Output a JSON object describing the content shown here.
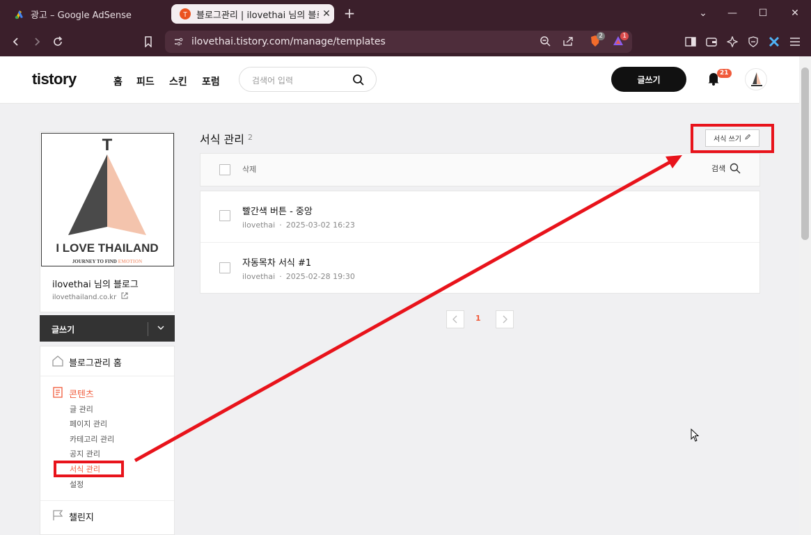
{
  "browser": {
    "tabs": [
      {
        "title": "광고 – Google AdSense",
        "active": false
      },
      {
        "title": "블로그관리 | ilovethai 님의 블로그",
        "active": true
      }
    ],
    "url": "ilovethai.tistory.com/manage/templates",
    "brave_shield_count": "2",
    "brave_rewards_count": "1"
  },
  "header": {
    "logo": "tistory",
    "nav": [
      "홈",
      "피드",
      "스킨",
      "포럼"
    ],
    "search_placeholder": "검색어 입력",
    "write_label": "글쓰기",
    "notification_count": "21"
  },
  "sidebar": {
    "profile_image_text": {
      "letter": "T",
      "headline": "I LOVE THAILAND",
      "tagline_a": "JOURNEY TO FIND ",
      "tagline_b": "EMOTION"
    },
    "blog_name": "ilovethai 님의 블로그",
    "blog_url": "ilovethailand.co.kr",
    "write_label": "글쓰기",
    "menu": {
      "home": "블로그관리 홈",
      "contents": "콘텐츠",
      "contents_items": [
        "글 관리",
        "페이지 관리",
        "카테고리 관리",
        "공지 관리",
        "서식 관리",
        "설정"
      ],
      "challenge": "챌린지"
    }
  },
  "main": {
    "title": "서식 관리",
    "count": "2",
    "new_template_label": "서식 쓰기",
    "delete_label": "삭제",
    "search_label": "검색",
    "templates": [
      {
        "title": "빨간색 버튼 - 중앙",
        "author": "ilovethai",
        "date": "2025-03-02 16:23"
      },
      {
        "title": "자동목차 서식 #1",
        "author": "ilovethai",
        "date": "2025-02-28 19:30"
      }
    ],
    "current_page": "1"
  },
  "colors": {
    "accent": "#f05a3a",
    "annotation": "#e8131b",
    "chrome": "#3b1f2b"
  }
}
